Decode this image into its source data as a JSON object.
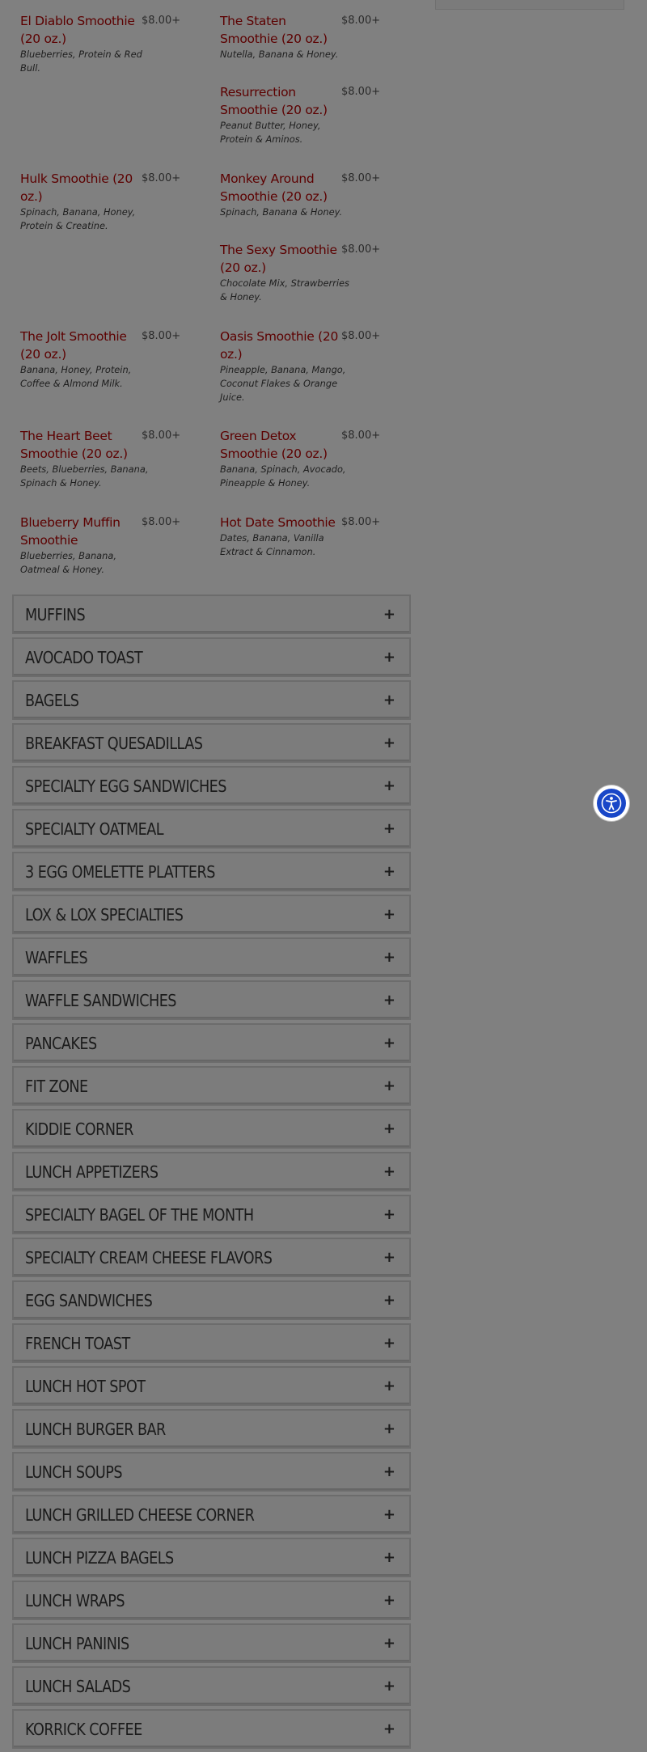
{
  "smoothies": [
    {
      "name": "El Diablo Smoothie (20 oz.)",
      "price": "$8.00+",
      "desc": "Blueberries, Protein & Red Bull."
    },
    {
      "name": "The Staten Smoothie (20 oz.)",
      "price": "$8.00+",
      "desc": "Nutella, Banana & Honey."
    },
    {
      "name": "",
      "price": "",
      "desc": ""
    },
    {
      "name": "Resurrection Smoothie (20 oz.)",
      "price": "$8.00+",
      "desc": "Peanut Butter, Honey, Protein & Aminos."
    },
    {
      "name": "Hulk Smoothie (20 oz.)",
      "price": "$8.00+",
      "desc": "Spinach, Banana, Honey, Protein & Creatine."
    },
    {
      "name": "Monkey Around Smoothie (20 oz.)",
      "price": "$8.00+",
      "desc": "Spinach, Banana & Honey."
    },
    {
      "name": "",
      "price": "",
      "desc": ""
    },
    {
      "name": "The Sexy Smoothie (20 oz.)",
      "price": "$8.00+",
      "desc": "Chocolate Mix, Strawberries & Honey."
    },
    {
      "name": "The Jolt Smoothie (20 oz.)",
      "price": "$8.00+",
      "desc": "Banana, Honey, Protein, Coffee & Almond Milk."
    },
    {
      "name": "Oasis Smoothie (20 oz.)",
      "price": "$8.00+",
      "desc": "Pineapple, Banana, Mango, Coconut Flakes & Orange Juice."
    },
    {
      "name": "The Heart Beet Smoothie (20 oz.)",
      "price": "$8.00+",
      "desc": "Beets, Blueberries, Banana, Spinach & Honey."
    },
    {
      "name": "Green Detox Smoothie (20 oz.)",
      "price": "$8.00+",
      "desc": "Banana, Spinach, Avocado, Pineapple & Honey."
    },
    {
      "name": "Blueberry Muffin Smoothie",
      "price": "$8.00+",
      "desc": "Blueberries, Banana, Oatmeal & Honey."
    },
    {
      "name": "Hot Date Smoothie",
      "price": "$8.00+",
      "desc": "Dates, Banana, Vanilla Extract & Cinnamon."
    }
  ],
  "categories": [
    "MUFFINS",
    "AVOCADO TOAST",
    "BAGELS",
    "BREAKFAST QUESADILLAS",
    "SPECIALTY EGG SANDWICHES",
    "SPECIALTY OATMEAL",
    "3 EGG OMELETTE PLATTERS",
    "LOX & LOX SPECIALTIES",
    "WAFFLES",
    "WAFFLE SANDWICHES",
    "PANCAKES",
    "FIT ZONE",
    "KIDDIE CORNER",
    "LUNCH APPETIZERS",
    "SPECIALTY BAGEL OF THE MONTH",
    "SPECIALTY CREAM CHEESE FLAVORS",
    "EGG SANDWICHES",
    "FRENCH TOAST",
    "LUNCH HOT SPOT",
    "LUNCH BURGER BAR",
    "LUNCH SOUPS",
    "LUNCH GRILLED CHEESE CORNER",
    "LUNCH PIZZA BAGELS",
    "LUNCH WRAPS",
    "LUNCH PANINIS",
    "LUNCH SALADS",
    "KORRICK COFFEE"
  ],
  "expand_symbol": "+",
  "colors": {
    "overlay_bg": "#808080",
    "item_name": "#5c0000",
    "accessibility_blue": "#1947c8"
  },
  "icons": {
    "accessibility": "accessibility-icon"
  }
}
